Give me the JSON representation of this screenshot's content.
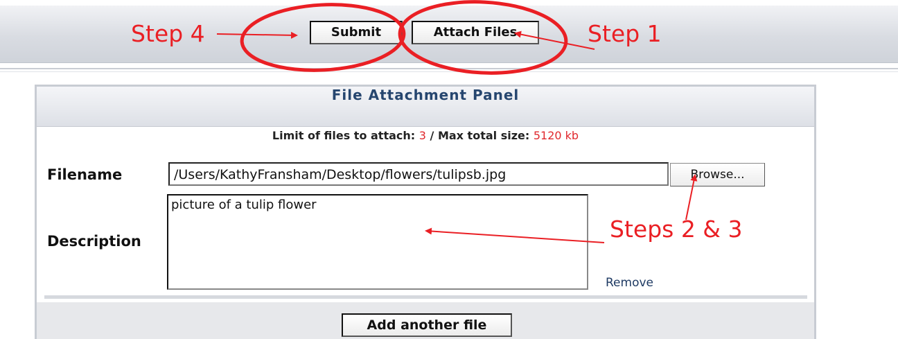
{
  "toolbar": {
    "submit_label": "Submit",
    "attach_label": "Attach Files"
  },
  "panel": {
    "title": "File Attachment Panel",
    "limit_label": "Limit of files to attach:",
    "limit_value": "3",
    "separator": "/",
    "max_size_label": "Max total size:",
    "max_size_value": "5120 kb",
    "filename_label": "Filename",
    "filename_value": "/Users/KathyFransham/Desktop/flowers/tulipsb.jpg",
    "browse_label": "Browse...",
    "description_label": "Description",
    "description_value": "picture of a tulip flower",
    "remove_label": "Remove",
    "add_file_label": "Add another file"
  },
  "annotations": {
    "step4": "Step 4",
    "step1": "Step 1",
    "steps23": "Steps 2 & 3",
    "color": "#ea1f24"
  },
  "colors": {
    "panel_title": "#26466f",
    "highlight_value": "#e0282d",
    "link": "#1e3a63"
  }
}
